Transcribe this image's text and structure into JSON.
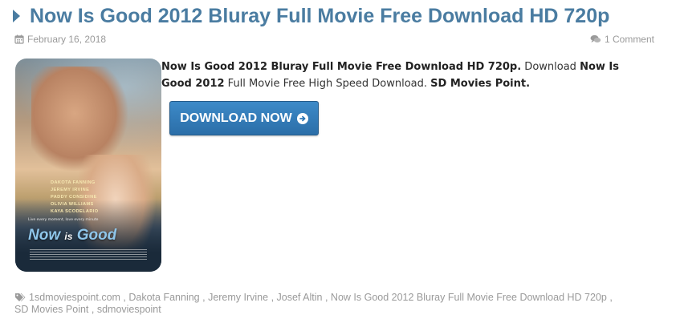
{
  "post": {
    "title": "Now Is Good 2012 Bluray Full Movie Free Download HD 720p",
    "date": "February 16, 2018",
    "comments": "1 Comment"
  },
  "poster": {
    "cast": [
      "DAKOTA FANNING",
      "JEREMY IRVINE",
      "PADDY CONSIDINE",
      "OLIVIA WILLIAMS",
      "KAYA SCODELARIO"
    ],
    "tagline": "Live every moment, love every minute",
    "logo_now": "Now",
    "logo_is": "is",
    "logo_good": "Good"
  },
  "description": {
    "part1_bold": "Now Is Good 2012 Bluray Full Movie Free Download HD 720p.",
    "part2": " Download ",
    "part3_bold": "Now Is Good 2012",
    "part4": " Full Movie Free High Speed Download. ",
    "part5_bold": "SD Movies Point."
  },
  "download_button": {
    "label": "DOWNLOAD NOW"
  },
  "tags": {
    "items": [
      "1sdmoviespoint.com",
      "Dakota Fanning",
      "Jeremy Irvine",
      "Josef Altin",
      "Now Is Good 2012 Bluray Full Movie Free Download HD 720p",
      "SD Movies Point",
      "sdmoviespoint"
    ]
  },
  "colors": {
    "title": "#4a7ca1",
    "meta": "#9a9a9a",
    "button": "#2f78b6"
  },
  "icons": {
    "title": "caret-right-icon",
    "date": "calendar-icon",
    "comments": "comments-icon",
    "download": "arrow-circle-right-icon",
    "tags": "tags-icon"
  }
}
